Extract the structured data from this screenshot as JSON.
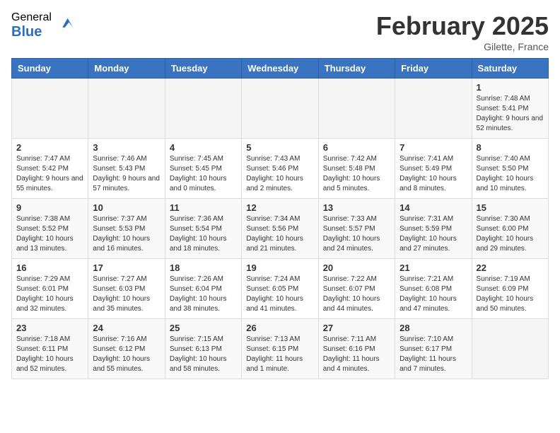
{
  "header": {
    "logo": {
      "general": "General",
      "blue": "Blue"
    },
    "title": "February 2025",
    "location": "Gilette, France"
  },
  "calendar": {
    "days_of_week": [
      "Sunday",
      "Monday",
      "Tuesday",
      "Wednesday",
      "Thursday",
      "Friday",
      "Saturday"
    ],
    "weeks": [
      [
        {
          "day": "",
          "info": ""
        },
        {
          "day": "",
          "info": ""
        },
        {
          "day": "",
          "info": ""
        },
        {
          "day": "",
          "info": ""
        },
        {
          "day": "",
          "info": ""
        },
        {
          "day": "",
          "info": ""
        },
        {
          "day": "1",
          "info": "Sunrise: 7:48 AM\nSunset: 5:41 PM\nDaylight: 9 hours and 52 minutes."
        }
      ],
      [
        {
          "day": "2",
          "info": "Sunrise: 7:47 AM\nSunset: 5:42 PM\nDaylight: 9 hours and 55 minutes."
        },
        {
          "day": "3",
          "info": "Sunrise: 7:46 AM\nSunset: 5:43 PM\nDaylight: 9 hours and 57 minutes."
        },
        {
          "day": "4",
          "info": "Sunrise: 7:45 AM\nSunset: 5:45 PM\nDaylight: 10 hours and 0 minutes."
        },
        {
          "day": "5",
          "info": "Sunrise: 7:43 AM\nSunset: 5:46 PM\nDaylight: 10 hours and 2 minutes."
        },
        {
          "day": "6",
          "info": "Sunrise: 7:42 AM\nSunset: 5:48 PM\nDaylight: 10 hours and 5 minutes."
        },
        {
          "day": "7",
          "info": "Sunrise: 7:41 AM\nSunset: 5:49 PM\nDaylight: 10 hours and 8 minutes."
        },
        {
          "day": "8",
          "info": "Sunrise: 7:40 AM\nSunset: 5:50 PM\nDaylight: 10 hours and 10 minutes."
        }
      ],
      [
        {
          "day": "9",
          "info": "Sunrise: 7:38 AM\nSunset: 5:52 PM\nDaylight: 10 hours and 13 minutes."
        },
        {
          "day": "10",
          "info": "Sunrise: 7:37 AM\nSunset: 5:53 PM\nDaylight: 10 hours and 16 minutes."
        },
        {
          "day": "11",
          "info": "Sunrise: 7:36 AM\nSunset: 5:54 PM\nDaylight: 10 hours and 18 minutes."
        },
        {
          "day": "12",
          "info": "Sunrise: 7:34 AM\nSunset: 5:56 PM\nDaylight: 10 hours and 21 minutes."
        },
        {
          "day": "13",
          "info": "Sunrise: 7:33 AM\nSunset: 5:57 PM\nDaylight: 10 hours and 24 minutes."
        },
        {
          "day": "14",
          "info": "Sunrise: 7:31 AM\nSunset: 5:59 PM\nDaylight: 10 hours and 27 minutes."
        },
        {
          "day": "15",
          "info": "Sunrise: 7:30 AM\nSunset: 6:00 PM\nDaylight: 10 hours and 29 minutes."
        }
      ],
      [
        {
          "day": "16",
          "info": "Sunrise: 7:29 AM\nSunset: 6:01 PM\nDaylight: 10 hours and 32 minutes."
        },
        {
          "day": "17",
          "info": "Sunrise: 7:27 AM\nSunset: 6:03 PM\nDaylight: 10 hours and 35 minutes."
        },
        {
          "day": "18",
          "info": "Sunrise: 7:26 AM\nSunset: 6:04 PM\nDaylight: 10 hours and 38 minutes."
        },
        {
          "day": "19",
          "info": "Sunrise: 7:24 AM\nSunset: 6:05 PM\nDaylight: 10 hours and 41 minutes."
        },
        {
          "day": "20",
          "info": "Sunrise: 7:22 AM\nSunset: 6:07 PM\nDaylight: 10 hours and 44 minutes."
        },
        {
          "day": "21",
          "info": "Sunrise: 7:21 AM\nSunset: 6:08 PM\nDaylight: 10 hours and 47 minutes."
        },
        {
          "day": "22",
          "info": "Sunrise: 7:19 AM\nSunset: 6:09 PM\nDaylight: 10 hours and 50 minutes."
        }
      ],
      [
        {
          "day": "23",
          "info": "Sunrise: 7:18 AM\nSunset: 6:11 PM\nDaylight: 10 hours and 52 minutes."
        },
        {
          "day": "24",
          "info": "Sunrise: 7:16 AM\nSunset: 6:12 PM\nDaylight: 10 hours and 55 minutes."
        },
        {
          "day": "25",
          "info": "Sunrise: 7:15 AM\nSunset: 6:13 PM\nDaylight: 10 hours and 58 minutes."
        },
        {
          "day": "26",
          "info": "Sunrise: 7:13 AM\nSunset: 6:15 PM\nDaylight: 11 hours and 1 minute."
        },
        {
          "day": "27",
          "info": "Sunrise: 7:11 AM\nSunset: 6:16 PM\nDaylight: 11 hours and 4 minutes."
        },
        {
          "day": "28",
          "info": "Sunrise: 7:10 AM\nSunset: 6:17 PM\nDaylight: 11 hours and 7 minutes."
        },
        {
          "day": "",
          "info": ""
        }
      ]
    ]
  }
}
